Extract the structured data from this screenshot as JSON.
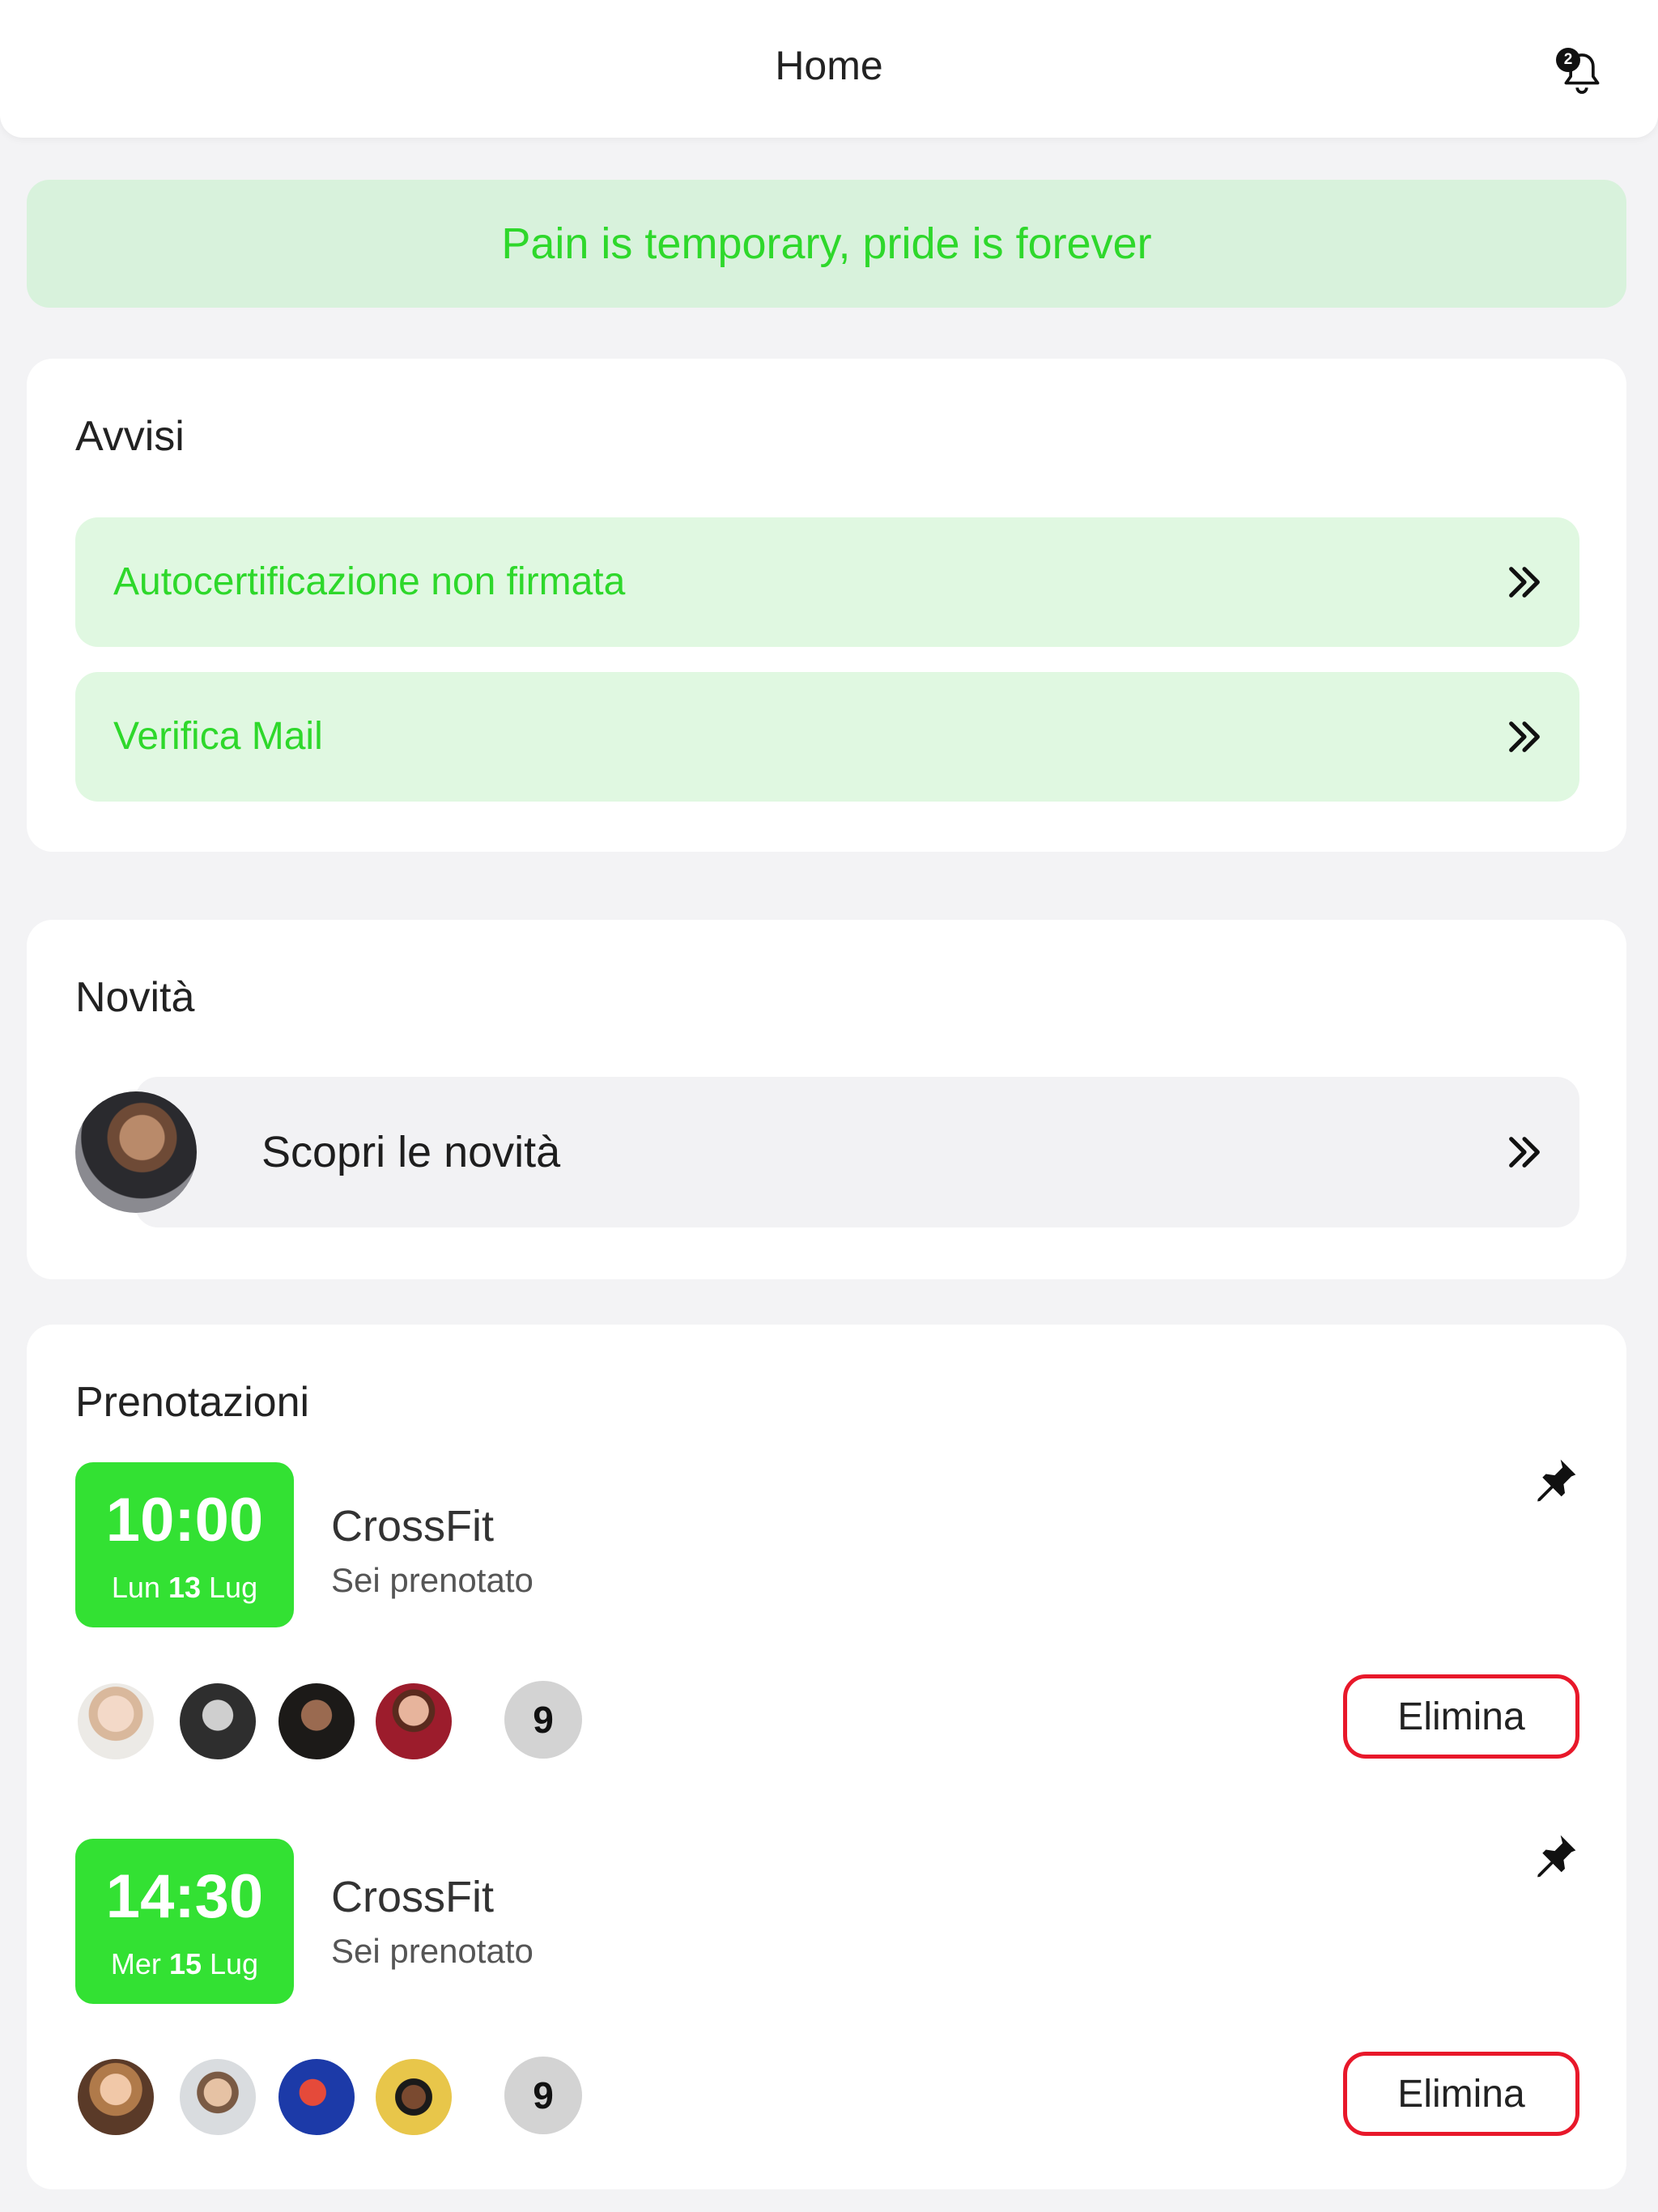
{
  "header": {
    "title": "Home",
    "notification_count": "2"
  },
  "motto": "Pain is temporary, pride is forever",
  "alerts": {
    "title": "Avvisi",
    "items": [
      {
        "label": "Autocertificazione non firmata"
      },
      {
        "label": "Verifica Mail"
      }
    ]
  },
  "news": {
    "title": "Novità",
    "item_label": "Scopri le novità"
  },
  "bookings": {
    "title": "Prenotazioni",
    "items": [
      {
        "time": "10:00",
        "weekday": "Lun",
        "day": "13",
        "month": "Lug",
        "class": "CrossFit",
        "status": "Sei prenotato",
        "participants_more": "9",
        "delete_label": "Elimina"
      },
      {
        "time": "14:30",
        "weekday": "Mer",
        "day": "15",
        "month": "Lug",
        "class": "CrossFit",
        "status": "Sei prenotato",
        "participants_more": "9",
        "delete_label": "Elimina"
      }
    ]
  },
  "colors": {
    "accent_green": "#33e133",
    "text_green": "#2ed82b",
    "motto_bg": "#d8f2dc",
    "alert_bg": "#e0f8e1",
    "delete_border": "#e8182a"
  }
}
